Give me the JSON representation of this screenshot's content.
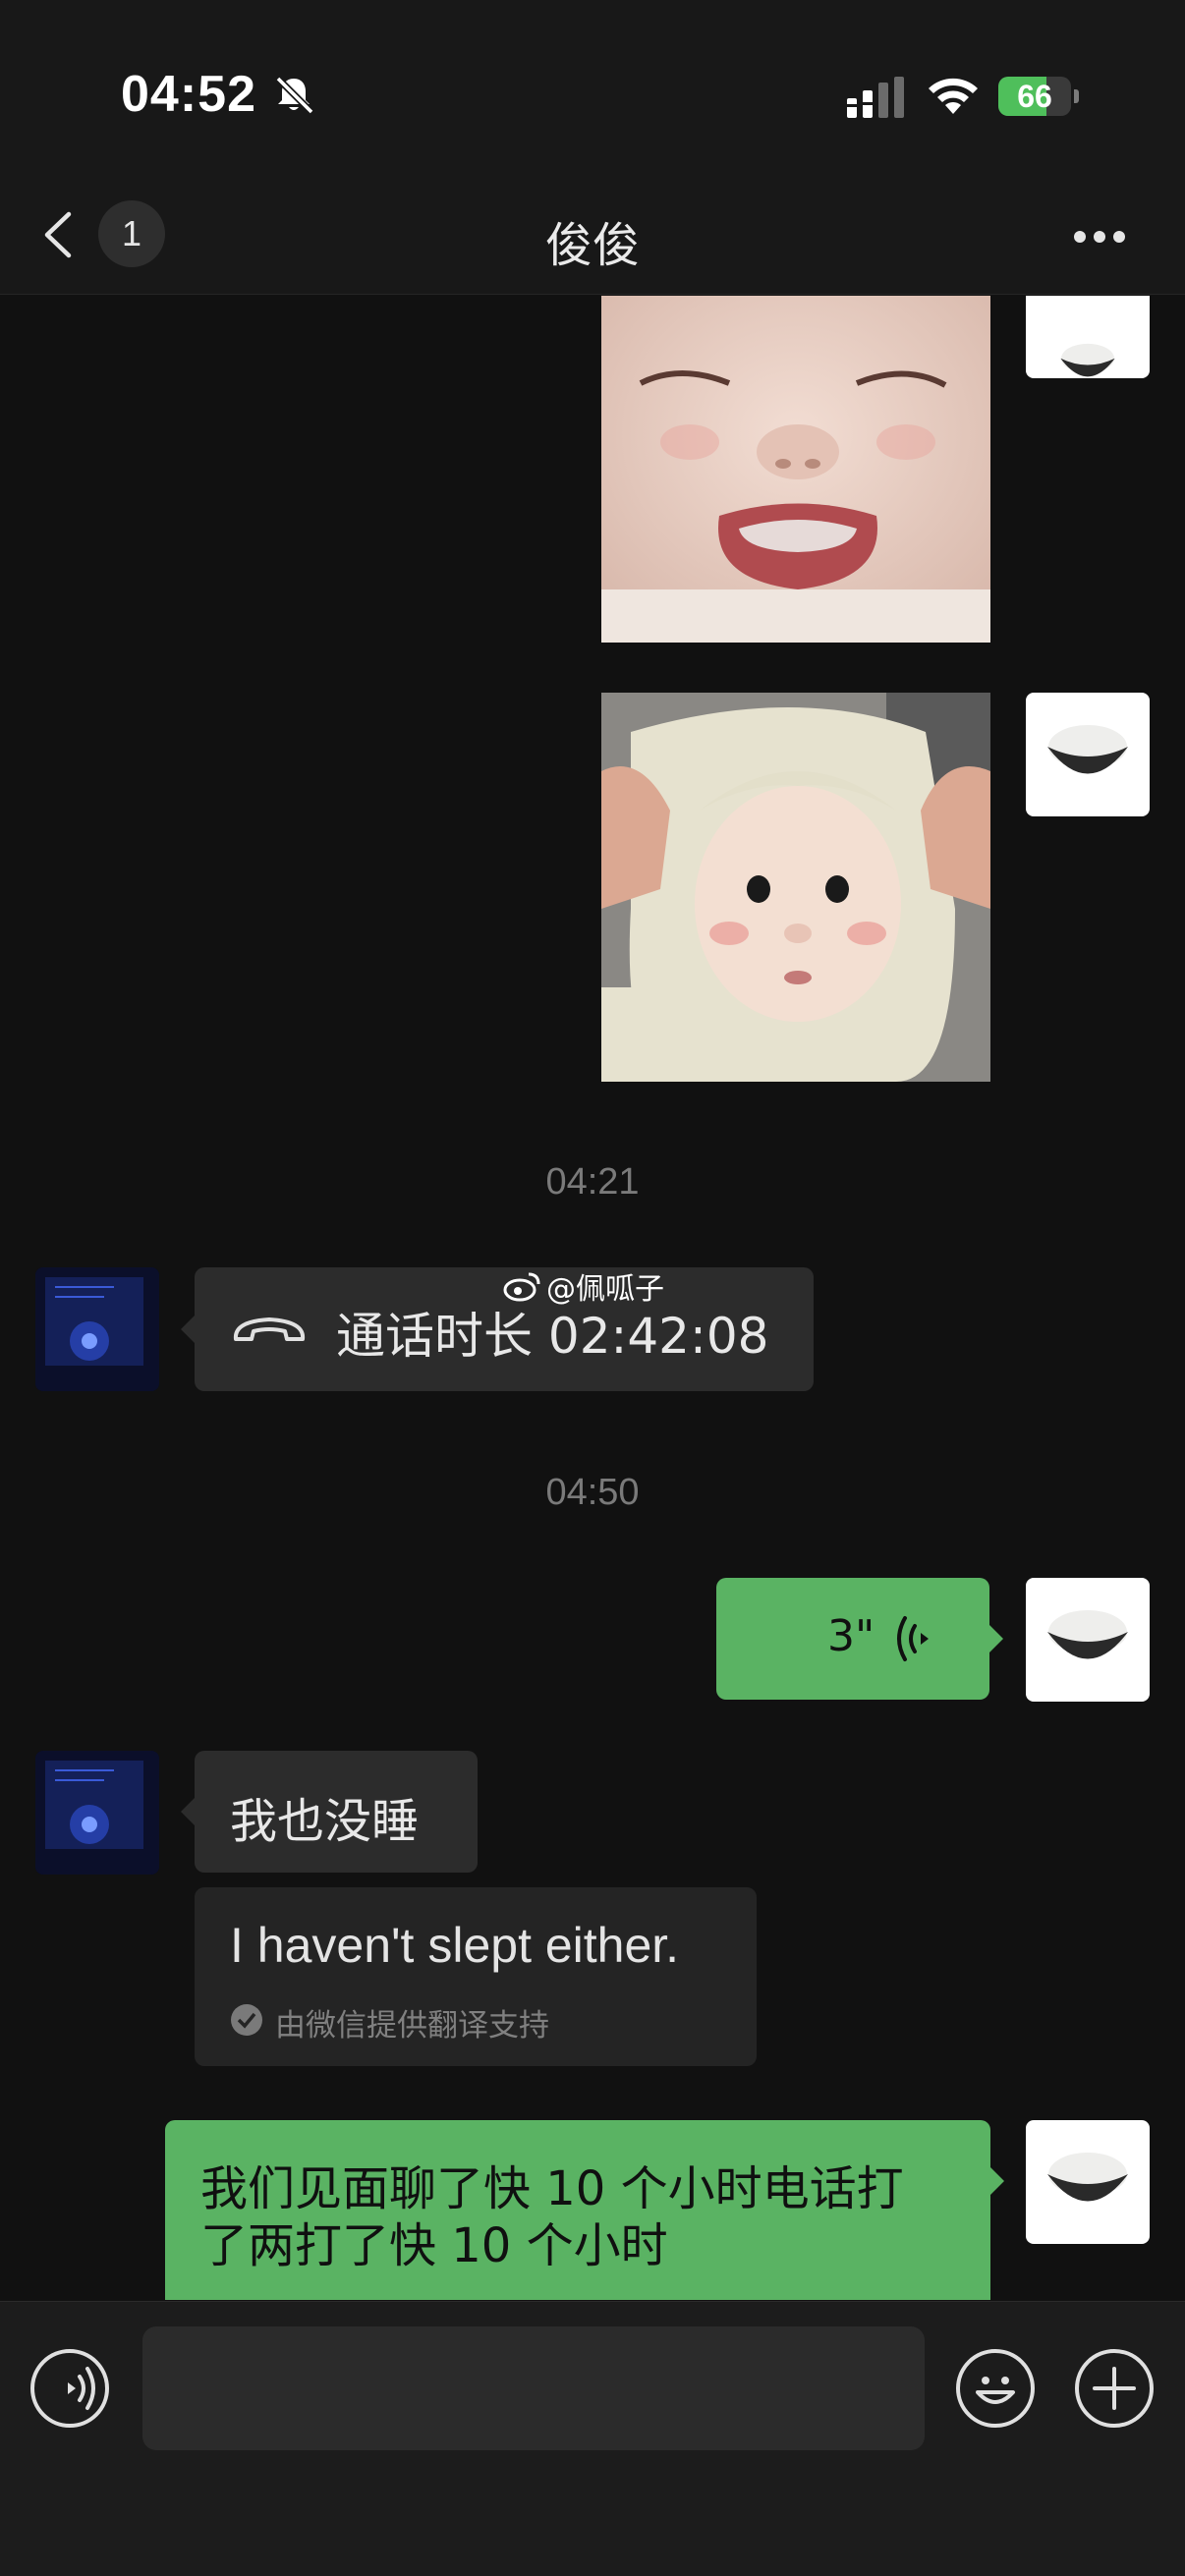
{
  "status_bar": {
    "time": "04:52",
    "battery_level": "66",
    "battery_fraction": 0.66
  },
  "nav": {
    "back_badge": "1",
    "title": "俊俊"
  },
  "messages": {
    "timestamp_1": "04:21",
    "call_text": "通话时长 02:42:08",
    "timestamp_2": "04:50",
    "voice_duration": "3\"",
    "reply_text": "我也没睡",
    "translation_text": "I haven't slept either.",
    "translation_note": "由微信提供翻译支持",
    "long_message_line1": "我们见面聊了快 10 个小时电话打",
    "long_message_line2": "了两打了快 10 个小时"
  },
  "watermark": {
    "text": "@佩呱子"
  },
  "input": {
    "value": ""
  },
  "colors": {
    "bubble_me": "#5ab363",
    "bubble_other": "#2c2c2c",
    "background": "#111111",
    "battery_green": "#4fbf5b"
  },
  "icons": [
    "bell-slash-icon",
    "signal-icon",
    "wifi-icon",
    "battery-icon",
    "back-icon",
    "more-icon",
    "phone-icon",
    "voice-wave-icon",
    "check-circle-icon",
    "voice-input-icon",
    "emoji-icon",
    "plus-icon",
    "weibo-icon"
  ]
}
